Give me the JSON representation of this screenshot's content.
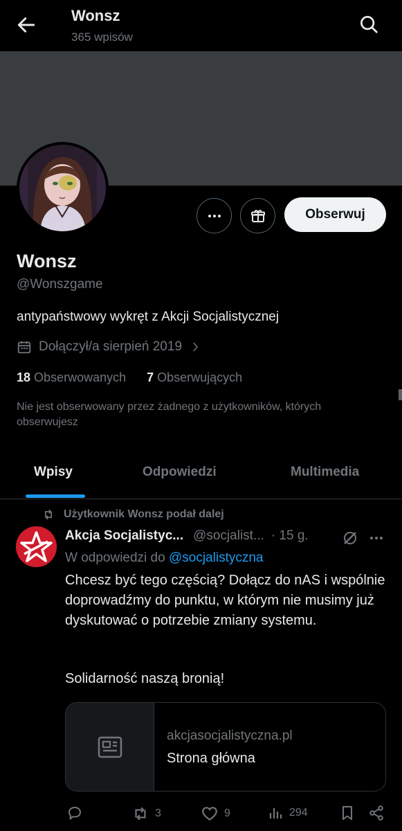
{
  "header": {
    "title": "Wonsz",
    "post_count": "365 wpisów"
  },
  "profile": {
    "name": "Wonsz",
    "handle": "@Wonszgame",
    "bio": "antypaństwowy wykręt z Akcji Socjalistycznej",
    "joined": "Dołączył/a sierpień 2019",
    "following_count": "18",
    "following_label": "Obserwowanych",
    "followers_count": "7",
    "followers_label": "Obserwujących",
    "mutual_note": "Nie jest obserwowany przez żadnego z użytkowników, których obserwujesz",
    "follow_label": "Obserwuj"
  },
  "tabs": [
    {
      "label": "Wpisy",
      "active": true
    },
    {
      "label": "Odpowiedzi",
      "active": false
    },
    {
      "label": "Multimedia",
      "active": false
    }
  ],
  "post": {
    "repost_note": "Użytkownik Wonsz podał dalej",
    "author_name": "Akcja Socjalistyc...",
    "author_handle": "@socjalist...",
    "time": "· 15 g.",
    "reply_prefix": "W odpowiedzi do",
    "reply_handle": "@socjalistyczna",
    "text": "Chcesz być tego częścią? Dołącz do nAS i wspólnie doprowadźmy do punktu, w którym nie musimy już dyskutować o potrzebie zmiany systemu.",
    "text2": "Solidarność naszą bronią!",
    "card_domain": "akcjasocjalistyczna.pl",
    "card_title": "Strona główna",
    "retweets": "3",
    "likes": "9",
    "views": "294"
  },
  "colors": {
    "accent": "#1d9bf0",
    "muted": "#71767b",
    "banner": "#3a3d40",
    "brand_red": "#d01c2c"
  }
}
